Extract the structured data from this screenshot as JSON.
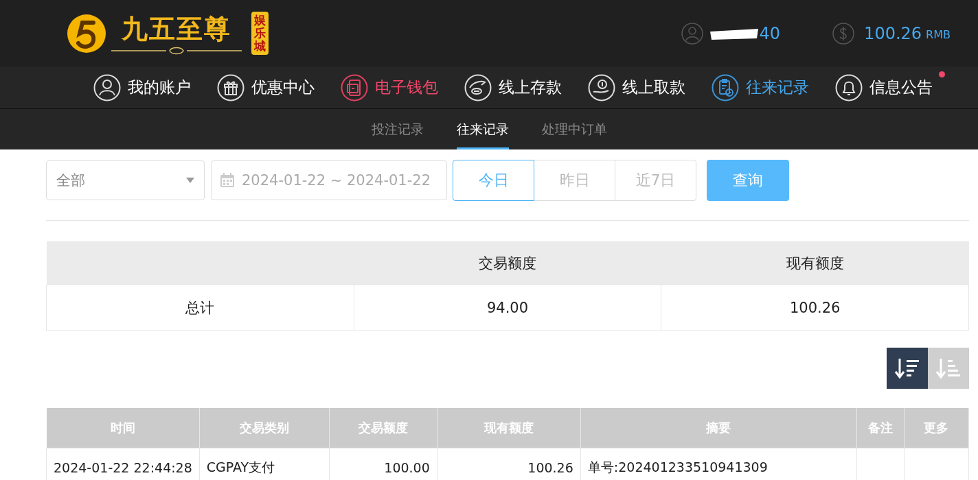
{
  "header": {
    "brand": "九五至尊",
    "brand_badge": "娱乐城",
    "username": "40",
    "balance": "100.26",
    "currency": "RMB"
  },
  "nav": [
    {
      "label": "我的账户",
      "kind": "user",
      "selected": false,
      "highlighted": false,
      "badge": false
    },
    {
      "label": "优惠中心",
      "kind": "gift",
      "selected": false,
      "highlighted": false,
      "badge": false
    },
    {
      "label": "电子钱包",
      "kind": "wallet",
      "selected": false,
      "highlighted": true,
      "badge": false
    },
    {
      "label": "线上存款",
      "kind": "deposit",
      "selected": false,
      "highlighted": false,
      "badge": false
    },
    {
      "label": "线上取款",
      "kind": "withdraw",
      "selected": false,
      "highlighted": false,
      "badge": false
    },
    {
      "label": "往来记录",
      "kind": "records",
      "selected": true,
      "highlighted": false,
      "badge": false
    },
    {
      "label": "信息公告",
      "kind": "bell",
      "selected": false,
      "highlighted": false,
      "badge": true
    }
  ],
  "subtabs": [
    {
      "label": "投注记录",
      "selected": false
    },
    {
      "label": "往来记录",
      "selected": true
    },
    {
      "label": "处理中订单",
      "selected": false
    }
  ],
  "filters": {
    "type_select": "全部",
    "date_range": "2024-01-22 ~ 2024-01-22",
    "quick_ranges": [
      {
        "label": "今日",
        "selected": true
      },
      {
        "label": "昨日",
        "selected": false
      },
      {
        "label": "近7日",
        "selected": false
      }
    ],
    "query_button": "查询"
  },
  "summary": {
    "columns": [
      "交易额度",
      "现有额度"
    ],
    "row_label": "总计",
    "values": [
      "94.00",
      "100.26"
    ]
  },
  "sort_buttons": [
    {
      "kind": "desc",
      "selected": true
    },
    {
      "kind": "asc",
      "selected": false
    }
  ],
  "table": {
    "columns": [
      "时间",
      "交易类别",
      "交易额度",
      "现有额度",
      "摘要",
      "备注",
      "更多"
    ],
    "rows": [
      [
        "2024-01-22 22:44:28",
        "CGPAY支付",
        "100.00",
        "100.26",
        "单号:202401233510941309",
        "",
        ""
      ]
    ]
  }
}
